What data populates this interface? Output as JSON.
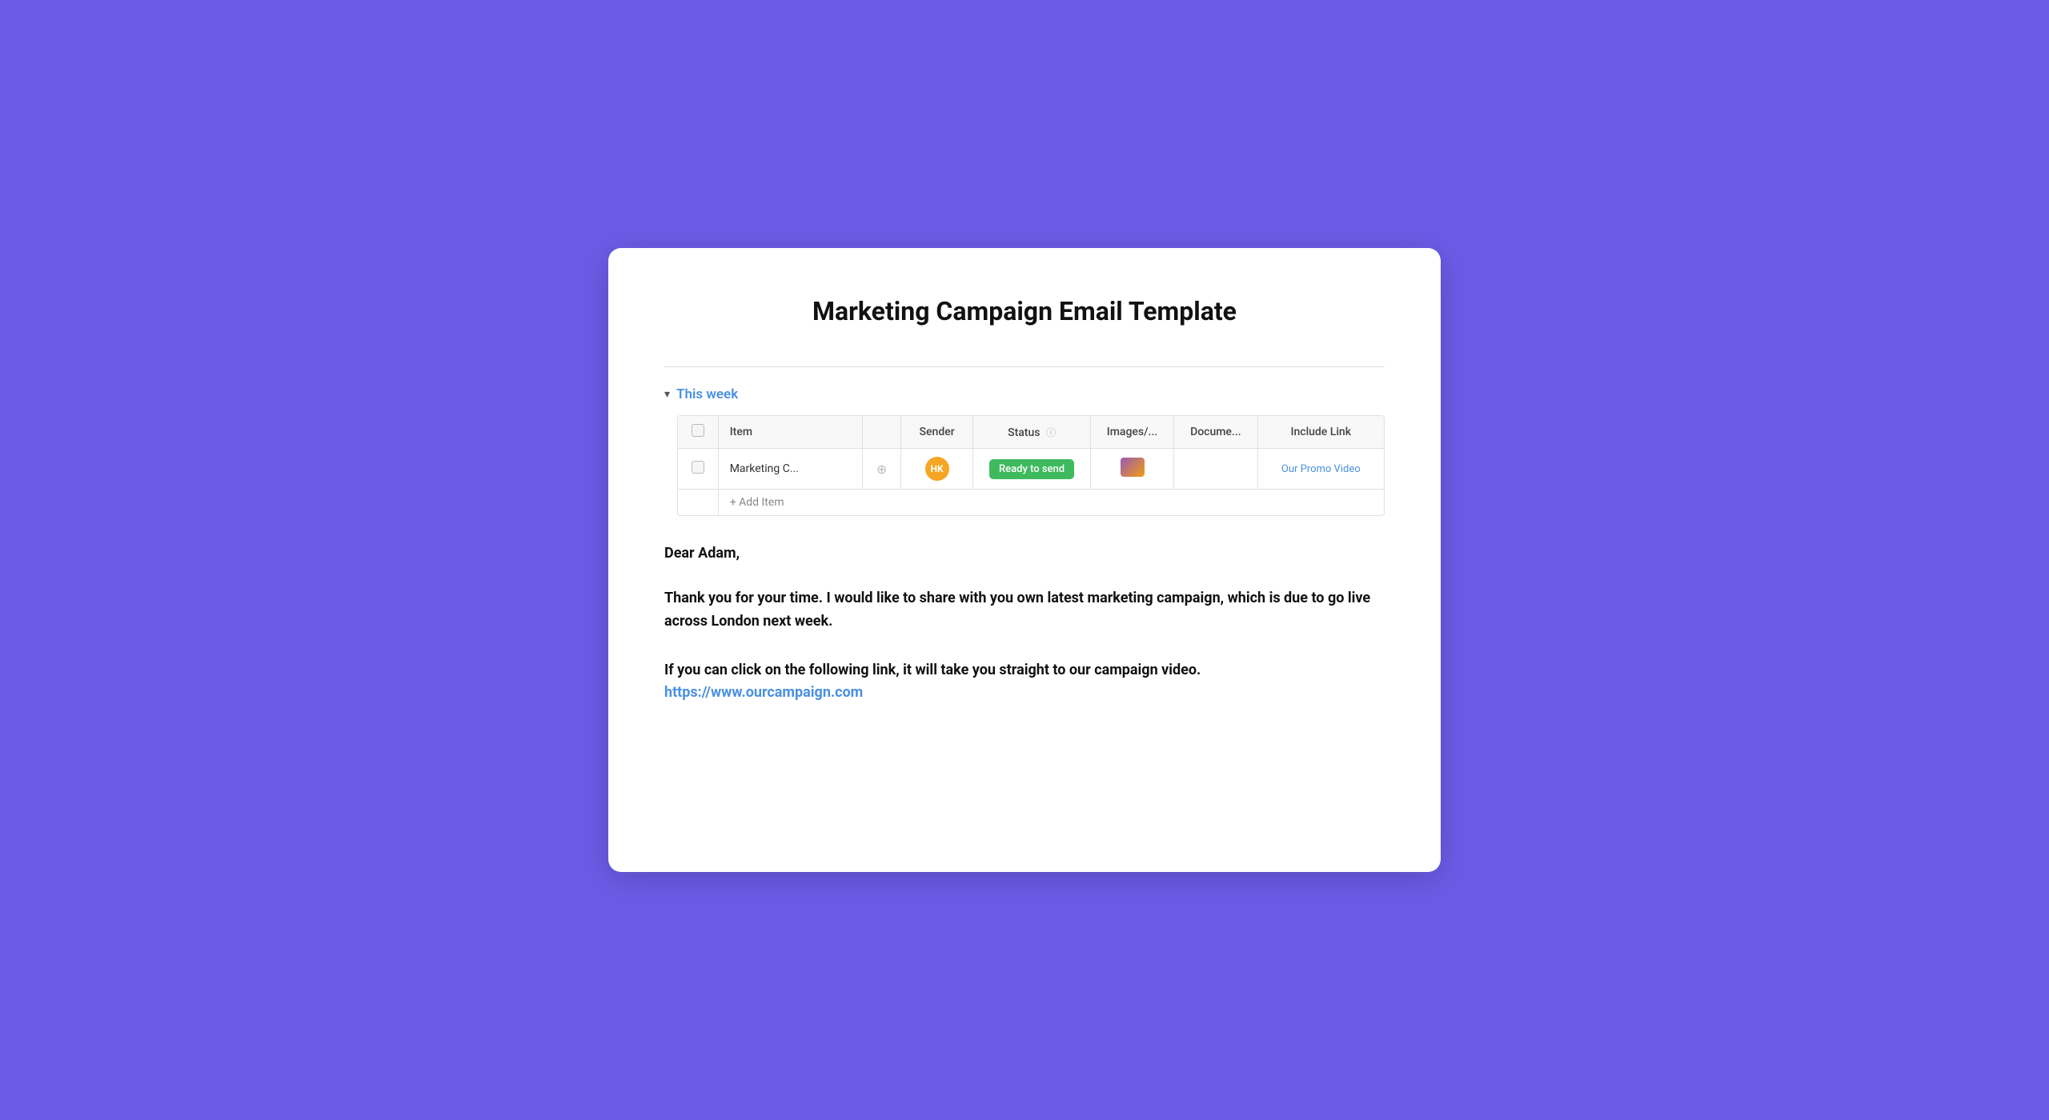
{
  "page": {
    "title": "Marketing Campaign Email Template",
    "background_color": "#6B5CE7"
  },
  "section": {
    "label": "This week",
    "chevron": "▾"
  },
  "table": {
    "columns": [
      {
        "key": "checkbox",
        "label": ""
      },
      {
        "key": "item",
        "label": "Item"
      },
      {
        "key": "sender_icon",
        "label": ""
      },
      {
        "key": "sender",
        "label": "Sender"
      },
      {
        "key": "status",
        "label": "Status"
      },
      {
        "key": "images",
        "label": "Images/..."
      },
      {
        "key": "documents",
        "label": "Docume..."
      },
      {
        "key": "include_link",
        "label": "Include Link"
      }
    ],
    "rows": [
      {
        "item": "Marketing C...",
        "sender_initials": "HK",
        "status": "Ready to send",
        "has_image": true,
        "link_text": "Our Promo Video"
      }
    ],
    "add_item_label": "+ Add Item"
  },
  "email": {
    "greeting": "Dear Adam,",
    "paragraph1": "Thank you for your time. I would like to share with you own latest marketing campaign, which is due to go live across London next week.",
    "paragraph2": "If you can click on the following link, it will take you straight to our campaign video.",
    "link_url": "https://www.ourcampaign.com",
    "link_text": "https://www.ourcampaign.com"
  }
}
